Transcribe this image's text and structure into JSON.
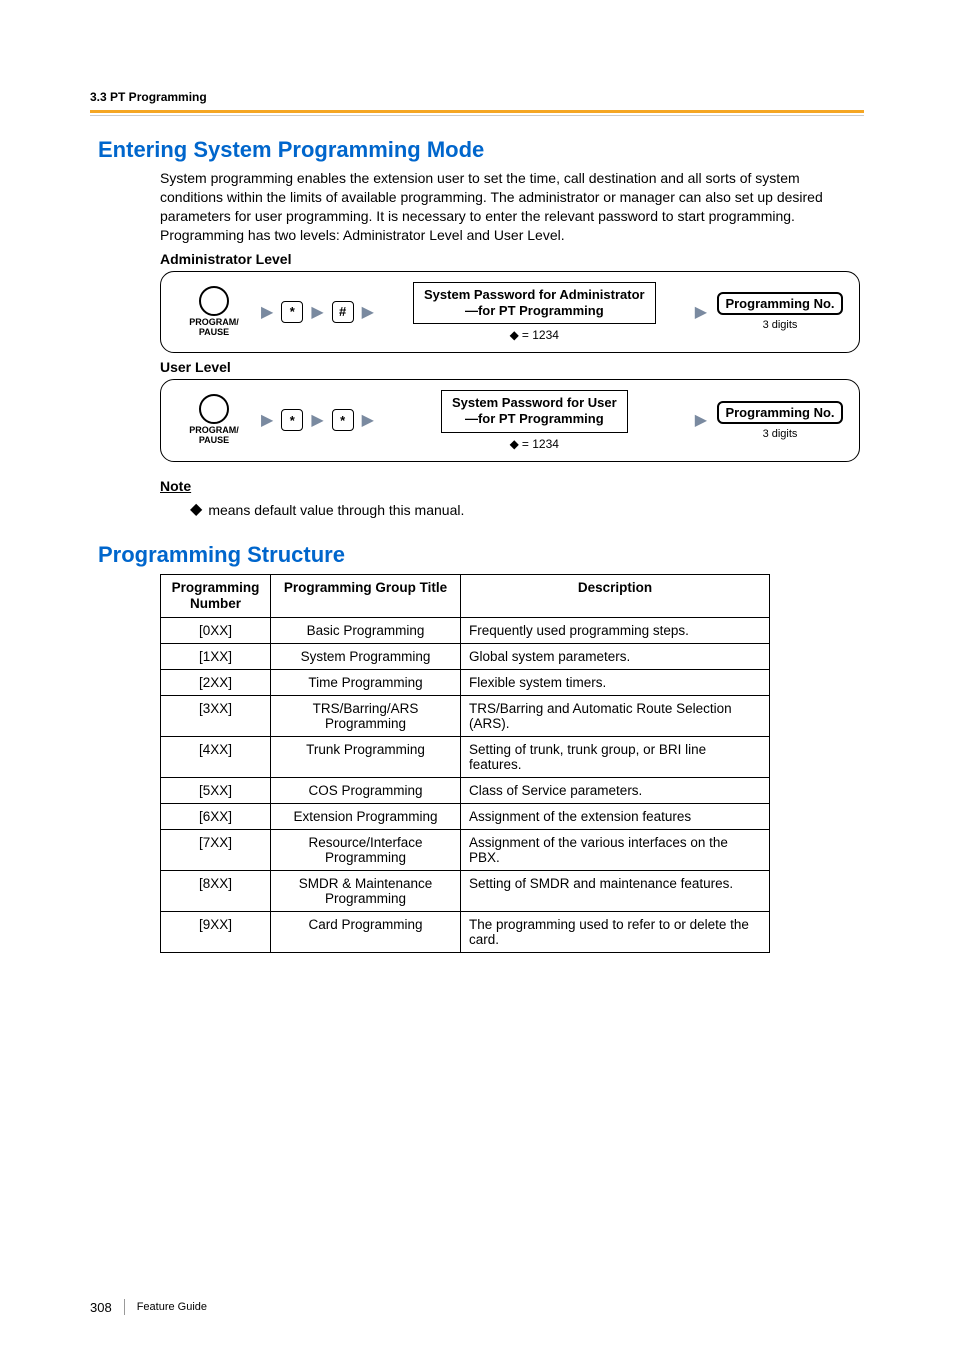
{
  "breadcrumb": "3.3 PT Programming",
  "section1": {
    "title": "Entering System Programming Mode",
    "para": "System programming enables the extension user to set the time, call destination and all sorts of system conditions within the limits of available programming. The administrator or manager can also set up desired parameters for user programming. It is necessary to enter the relevant password to start programming. Programming has two levels: Administrator Level and User Level.",
    "admin_label": "Administrator Level",
    "user_label": "User Level",
    "pp_label": "PROGRAM/\nPAUSE",
    "key_star": "*",
    "key_hash": "#",
    "admin_pw_line1": "System Password for Administrator",
    "admin_pw_line2": "—for PT Programming",
    "user_pw_line1": "System Password for User",
    "user_pw_line2": "—for PT Programming",
    "default_eq": "= 1234",
    "pn_label": "Programming No.",
    "pn_sub": "3 digits",
    "note_head": "Note",
    "note_text": "means default value through this manual."
  },
  "section2": {
    "title": "Programming Structure",
    "headers": {
      "c1": "Programming Number",
      "c2": "Programming Group Title",
      "c3": "Description"
    },
    "rows": [
      {
        "n": "[0XX]",
        "t": "Basic Programming",
        "d": "Frequently used programming steps."
      },
      {
        "n": "[1XX]",
        "t": "System Programming",
        "d": "Global system parameters."
      },
      {
        "n": "[2XX]",
        "t": "Time Programming",
        "d": "Flexible system timers."
      },
      {
        "n": "[3XX]",
        "t": "TRS/Barring/ARS Programming",
        "d": "TRS/Barring and Automatic Route Selection (ARS)."
      },
      {
        "n": "[4XX]",
        "t": "Trunk Programming",
        "d": "Setting of trunk, trunk group, or BRI line features."
      },
      {
        "n": "[5XX]",
        "t": "COS Programming",
        "d": "Class of Service parameters."
      },
      {
        "n": "[6XX]",
        "t": "Extension Programming",
        "d": "Assignment of the extension features"
      },
      {
        "n": "[7XX]",
        "t": "Resource/Interface Programming",
        "d": "Assignment of the various interfaces on the PBX."
      },
      {
        "n": "[8XX]",
        "t": "SMDR & Maintenance Programming",
        "d": "Setting of SMDR and maintenance features."
      },
      {
        "n": "[9XX]",
        "t": "Card Programming",
        "d": "The programming used to refer to or delete the card."
      }
    ]
  },
  "footer": {
    "page": "308",
    "doc": "Feature Guide"
  }
}
